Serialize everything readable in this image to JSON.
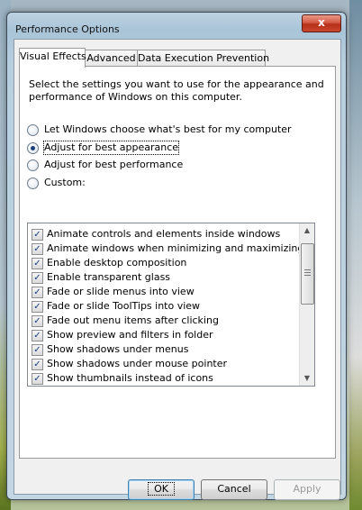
{
  "window": {
    "title": "Performance Options",
    "close_label": "x"
  },
  "tabs": [
    {
      "label": "Visual Effects",
      "active": true
    },
    {
      "label": "Advanced",
      "active": false
    },
    {
      "label": "Data Execution Prevention",
      "active": false
    }
  ],
  "visual_effects": {
    "description": "Select the settings you want to use for the appearance and performance of Windows on this computer.",
    "options": [
      {
        "label": "Let Windows choose what's best for my computer",
        "selected": false
      },
      {
        "label": "Adjust for best appearance",
        "selected": true
      },
      {
        "label": "Adjust for best performance",
        "selected": false
      },
      {
        "label": "Custom:",
        "selected": false
      }
    ],
    "effects": [
      {
        "label": "Animate controls and elements inside windows",
        "checked": true
      },
      {
        "label": "Animate windows when minimizing and maximizing",
        "checked": true
      },
      {
        "label": "Enable desktop composition",
        "checked": true
      },
      {
        "label": "Enable transparent glass",
        "checked": true
      },
      {
        "label": "Fade or slide menus into view",
        "checked": true
      },
      {
        "label": "Fade or slide ToolTips into view",
        "checked": true
      },
      {
        "label": "Fade out menu items after clicking",
        "checked": true
      },
      {
        "label": "Show preview and filters in folder",
        "checked": true
      },
      {
        "label": "Show shadows under menus",
        "checked": true
      },
      {
        "label": "Show shadows under mouse pointer",
        "checked": true
      },
      {
        "label": "Show thumbnails instead of icons",
        "checked": true
      }
    ],
    "checkmark": "✓"
  },
  "buttons": {
    "ok": "OK",
    "cancel": "Cancel",
    "apply": "Apply"
  },
  "icons": {
    "scroll_up": "▲",
    "scroll_down": "▼"
  }
}
